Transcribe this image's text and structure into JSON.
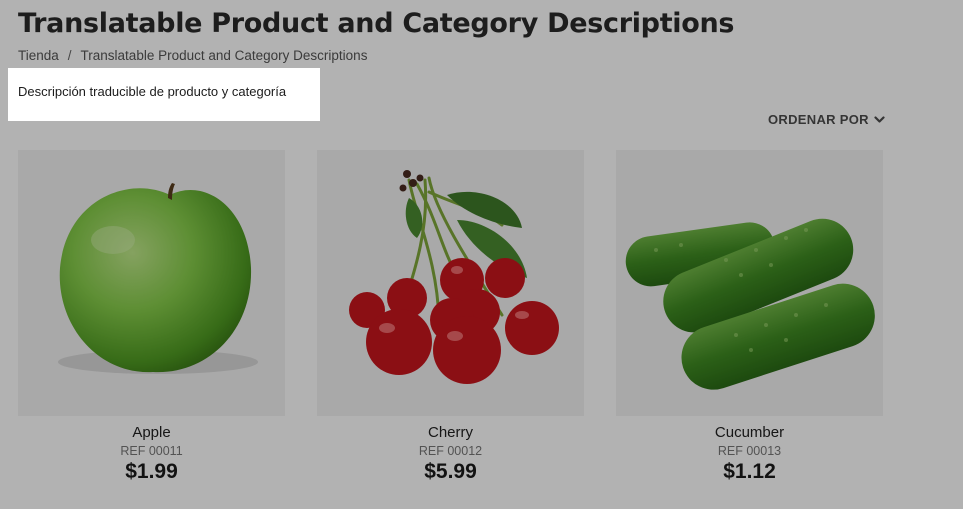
{
  "page": {
    "title": "Translatable Product and Category Descriptions"
  },
  "breadcrumb": {
    "items": [
      "Tienda",
      "Translatable Product and Category Descriptions"
    ],
    "separator": "/"
  },
  "category": {
    "description": "Descripción traducible de producto y categoría"
  },
  "sort": {
    "label": "ORDENAR POR",
    "icon": "chevron-down-icon"
  },
  "products": [
    {
      "name": "Apple",
      "ref": "REF 00011",
      "price": "$1.99",
      "image": "green-apple"
    },
    {
      "name": "Cherry",
      "ref": "REF 00012",
      "price": "$5.99",
      "image": "red-cherries"
    },
    {
      "name": "Cucumber",
      "ref": "REF 00013",
      "price": "$1.12",
      "image": "cucumbers"
    }
  ],
  "colors": {
    "overlay": "rgba(0,0,0,0.30)",
    "highlight": "#ffffff"
  }
}
